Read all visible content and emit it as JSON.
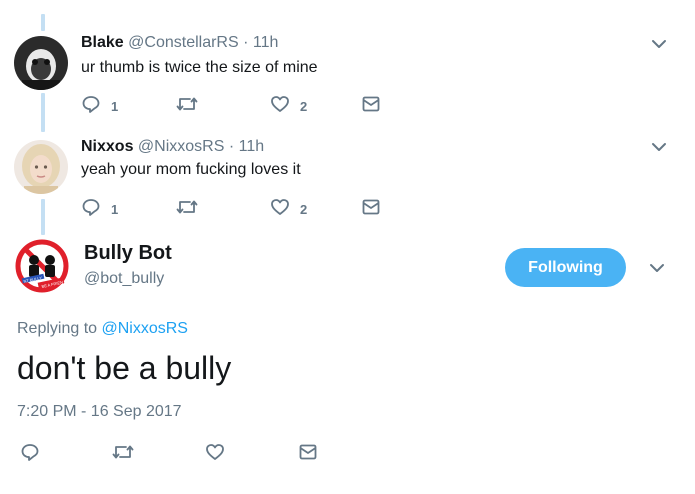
{
  "tweets": [
    {
      "name": "Blake",
      "handle": "@ConstellarRS",
      "time": "· 11h",
      "text": "ur thumb is twice the size of mine",
      "reply_count": "1",
      "like_count": "2"
    },
    {
      "name": "Nixxos",
      "handle": "@NixxosRS",
      "time": "· 11h",
      "text": "yeah your mom fucking loves it",
      "reply_count": "1",
      "like_count": "2"
    }
  ],
  "main": {
    "name": "Bully Bot",
    "handle": "@bot_bully",
    "follow_label": "Following",
    "replying_prefix": "Replying to ",
    "replying_to": "@NixxosRS",
    "text": "don't be a bully",
    "timestamp": "7:20 PM - 16 Sep 2017",
    "avatar_text_1": "NT BULLY",
    "avatar_text_2": "BE A FRIEN"
  },
  "colors": {
    "accent": "#1da1f2",
    "follow_bg": "#4ab3f4",
    "muted": "#657786",
    "thread_line": "#c4dff3",
    "bully_red": "#e0202b"
  },
  "icons": [
    "reply-icon",
    "retweet-icon",
    "like-icon",
    "direct-message-icon",
    "chevron-down-icon"
  ]
}
